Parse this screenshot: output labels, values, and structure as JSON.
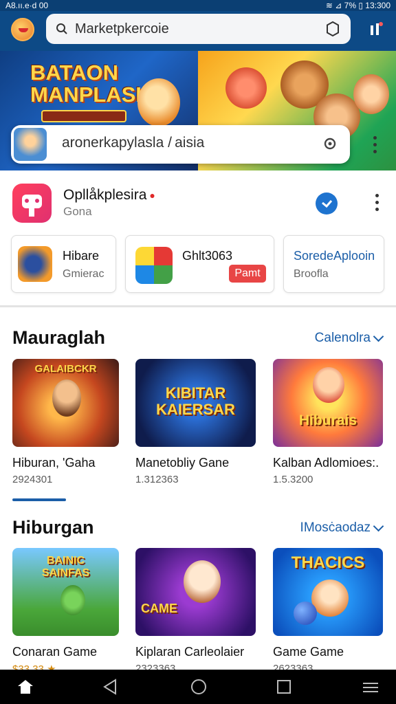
{
  "status_bar": {
    "left": "A8.ıı.e·d  00",
    "right": "≋  ⊿ 7%  ▯ 13:300"
  },
  "search": {
    "text": "Marketpkercoie"
  },
  "banner": {
    "title": "BATAON MANPLASIA"
  },
  "overlay_search": {
    "text": "aronerkapylasla / aisia"
  },
  "app": {
    "title": "Opllåkplesira",
    "subtitle": "Gona"
  },
  "mini_cards": [
    {
      "title": "Hibare",
      "subtitle": "Gmierac"
    },
    {
      "title": "Ghlt3063",
      "badge": "Pamt"
    },
    {
      "title": "SoredeAplooin",
      "subtitle": "Broofla"
    }
  ],
  "section1": {
    "title": "Mauraglah",
    "link": "Calenolra",
    "games": [
      {
        "art_label": "GALAIBCKR",
        "name": "Hiburan, 'Gaha",
        "sub": "2924301"
      },
      {
        "art_label": "KIBITAR KAIERSAR",
        "name": "Manetobliy Gane",
        "sub": "1.312363"
      },
      {
        "art_label": "Hiburais",
        "name": "Kalban Adlomioes:.",
        "sub": "1.5.3200"
      }
    ]
  },
  "section2": {
    "title": "Hiburgan",
    "link": "IMosċaodaz",
    "games": [
      {
        "art_label": "BAINIC SAINFAS",
        "name": "Conaran Game",
        "sub": "$33 33"
      },
      {
        "art_label": "CAME",
        "name": "Kiplaran Carleolaier",
        "sub": "2323363"
      },
      {
        "art_label": "THACICS",
        "name": "Game Game",
        "sub": "2623363"
      }
    ]
  },
  "colors": {
    "primary": "#0d4a86",
    "accent": "#1b5ea8",
    "badge": "#e84545"
  },
  "icons": [
    "avatar",
    "search-icon",
    "settings-icon",
    "more-icon",
    "verified-icon",
    "chevron-down-icon",
    "back-icon",
    "home-icon",
    "recents-icon"
  ]
}
